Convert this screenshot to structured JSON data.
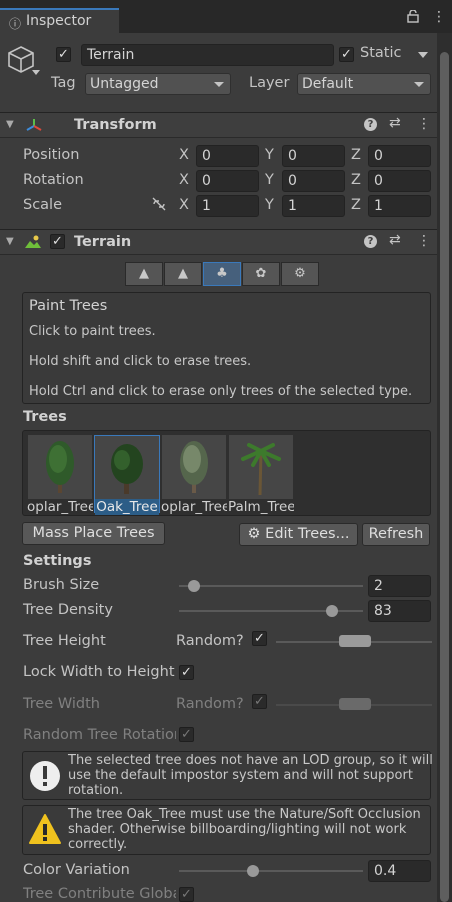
{
  "tab": {
    "icon": "info-icon",
    "title": "Inspector"
  },
  "object": {
    "name": "Terrain",
    "active": true,
    "static_label": "Static",
    "static": true,
    "tag_label": "Tag",
    "tag_value": "Untagged",
    "layer_label": "Layer",
    "layer_value": "Default"
  },
  "transform": {
    "title": "Transform",
    "rows": [
      {
        "label": "Position",
        "x": "0",
        "y": "0",
        "z": "0"
      },
      {
        "label": "Rotation",
        "x": "0",
        "y": "0",
        "z": "0"
      },
      {
        "label": "Scale",
        "x": "1",
        "y": "1",
        "z": "1"
      }
    ],
    "axis_x": "X",
    "axis_y": "Y",
    "axis_z": "Z"
  },
  "terrain": {
    "title": "Terrain",
    "enabled": true,
    "tools": [
      "raise-lower-icon",
      "paint-texture-icon",
      "paint-trees-icon",
      "paint-details-icon",
      "terrain-settings-icon"
    ],
    "active_tool_index": 2,
    "info": {
      "title": "Paint Trees",
      "line1": "Click to paint trees.",
      "line2": "Hold shift and click to erase trees.",
      "line3": "Hold Ctrl and click to erase only trees of the selected type."
    },
    "trees_label": "Trees",
    "trees": [
      {
        "label": "oplar_Tree",
        "selected": false,
        "kind": "poplar"
      },
      {
        "label": "Oak_Tree",
        "selected": true,
        "kind": "oak"
      },
      {
        "label": "oplar_Tree",
        "selected": false,
        "kind": "poplar-pale"
      },
      {
        "label": "Palm_Tree",
        "selected": false,
        "kind": "palm"
      }
    ],
    "mass_place_label": "Mass Place Trees",
    "edit_trees_label": "Edit Trees...",
    "refresh_label": "Refresh",
    "settings_label": "Settings",
    "brush_size": {
      "label": "Brush Size",
      "value": "2",
      "fraction": 0.08
    },
    "tree_density": {
      "label": "Tree Density",
      "value": "83",
      "fraction": 0.83
    },
    "tree_height": {
      "label": "Tree Height",
      "random_label": "Random?",
      "random": true
    },
    "lock_width": {
      "label": "Lock Width to Height",
      "checked": true
    },
    "tree_width": {
      "label": "Tree Width",
      "random_label": "Random?",
      "random": true
    },
    "random_rotation": {
      "label": "Random Tree Rotation",
      "checked": true
    },
    "lod_warning": {
      "line1": "The selected tree does not have an LOD group, so it will",
      "line2": "use the default impostor system and will not support",
      "line3": "rotation."
    },
    "shader_warning": {
      "line1": "The tree Oak_Tree must use the Nature/Soft Occlusion",
      "line2": "shader. Otherwise billboarding/lighting will not work",
      "line3": "correctly."
    },
    "color_variation": {
      "label": "Color Variation",
      "value": "0.4",
      "fraction": 0.4
    },
    "contribute_gi": {
      "label": "Tree Contribute Global Illumination",
      "checked": true
    }
  }
}
